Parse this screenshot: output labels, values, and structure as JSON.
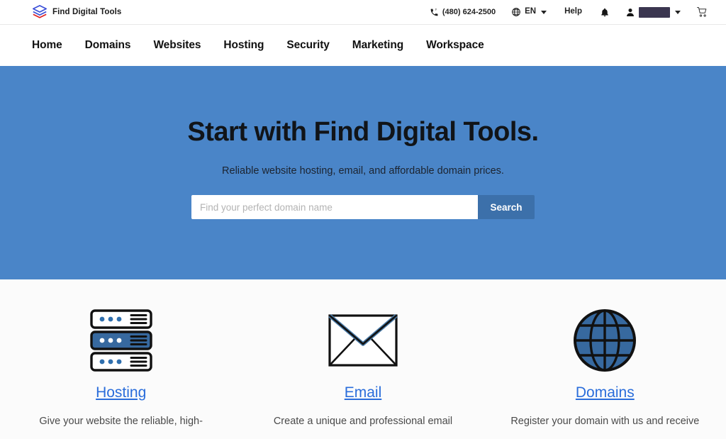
{
  "header": {
    "brand": {
      "name": "Find Digital Tools",
      "logo_icon": "layers-stack-icon",
      "logo_color_top": "#3b4fd8",
      "logo_color_mid": "#3b4fd8",
      "logo_color_bottom": "#e02020"
    },
    "phone": {
      "icon": "phone-icon",
      "number": "(480) 624-2500"
    },
    "language": {
      "icon": "globe-icon",
      "label": "EN",
      "caret": "chevron-down-icon"
    },
    "help_label": "Help",
    "notifications_icon": "bell-icon",
    "account": {
      "icon": "person-icon",
      "name": "",
      "redacted": true,
      "caret": "chevron-down-icon"
    },
    "cart_icon": "cart-icon"
  },
  "nav": {
    "items": [
      {
        "label": "Home"
      },
      {
        "label": "Domains"
      },
      {
        "label": "Websites"
      },
      {
        "label": "Hosting"
      },
      {
        "label": "Security"
      },
      {
        "label": "Marketing"
      },
      {
        "label": "Workspace"
      }
    ]
  },
  "hero": {
    "title": "Start with Find Digital Tools.",
    "subtitle": "Reliable website hosting, email, and affordable domain prices.",
    "background_color": "#4a85c8",
    "search": {
      "value": "",
      "placeholder": "Find your perfect domain name",
      "button_label": "Search",
      "button_color": "#3c70aa"
    }
  },
  "features": {
    "items": [
      {
        "icon": "server-rack-icon",
        "title": "Hosting",
        "description": "Give your website the reliable, high-"
      },
      {
        "icon": "envelope-icon",
        "title": "Email",
        "description": "Create a unique and professional email"
      },
      {
        "icon": "globe-icon",
        "title": "Domains",
        "description": "Register your domain with us and receive"
      }
    ],
    "link_color": "#2a6ddb"
  }
}
